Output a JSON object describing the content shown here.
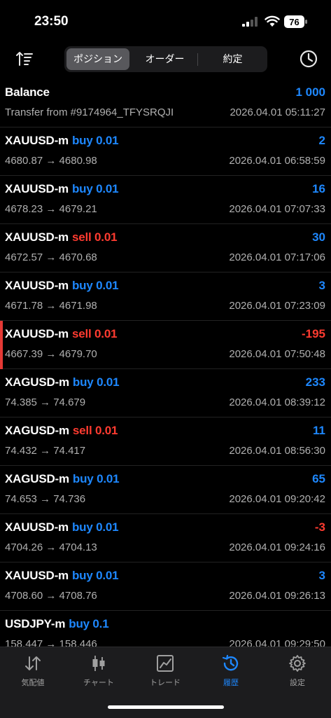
{
  "status": {
    "time": "23:50",
    "battery": "76"
  },
  "header": {
    "segments": [
      "ポジション",
      "オーダー",
      "約定"
    ],
    "active_segment": "ポジション"
  },
  "balance": {
    "label": "Balance",
    "amount": "1 000",
    "description": "Transfer from #9174964_TFYSRQJI",
    "time": "2026.04.01 05:11:27"
  },
  "deals": [
    {
      "symbol": "XAUUSD-m",
      "side": "buy 0.01",
      "type": "buy",
      "profit": "2",
      "profit_sign": "pos",
      "prices": "4680.87 → 4680.98",
      "time": "2026.04.01 06:58:59",
      "highlight": false
    },
    {
      "symbol": "XAUUSD-m",
      "side": "buy 0.01",
      "type": "buy",
      "profit": "16",
      "profit_sign": "pos",
      "prices": "4678.23 → 4679.21",
      "time": "2026.04.01 07:07:33",
      "highlight": false
    },
    {
      "symbol": "XAUUSD-m",
      "side": "sell 0.01",
      "type": "sell",
      "profit": "30",
      "profit_sign": "pos",
      "prices": "4672.57 → 4670.68",
      "time": "2026.04.01 07:17:06",
      "highlight": false
    },
    {
      "symbol": "XAUUSD-m",
      "side": "buy 0.01",
      "type": "buy",
      "profit": "3",
      "profit_sign": "pos",
      "prices": "4671.78 → 4671.98",
      "time": "2026.04.01 07:23:09",
      "highlight": false
    },
    {
      "symbol": "XAUUSD-m",
      "side": "sell 0.01",
      "type": "sell",
      "profit": "-195",
      "profit_sign": "neg",
      "prices": "4667.39 → 4679.70",
      "time": "2026.04.01 07:50:48",
      "highlight": true
    },
    {
      "symbol": "XAGUSD-m",
      "side": "buy 0.01",
      "type": "buy",
      "profit": "233",
      "profit_sign": "pos",
      "prices": "74.385 → 74.679",
      "time": "2026.04.01 08:39:12",
      "highlight": false
    },
    {
      "symbol": "XAGUSD-m",
      "side": "sell 0.01",
      "type": "sell",
      "profit": "11",
      "profit_sign": "pos",
      "prices": "74.432 → 74.417",
      "time": "2026.04.01 08:56:30",
      "highlight": false
    },
    {
      "symbol": "XAGUSD-m",
      "side": "buy 0.01",
      "type": "buy",
      "profit": "65",
      "profit_sign": "pos",
      "prices": "74.653 → 74.736",
      "time": "2026.04.01 09:20:42",
      "highlight": false
    },
    {
      "symbol": "XAUUSD-m",
      "side": "buy 0.01",
      "type": "buy",
      "profit": "-3",
      "profit_sign": "neg",
      "prices": "4704.26 → 4704.13",
      "time": "2026.04.01 09:24:16",
      "highlight": false
    },
    {
      "symbol": "XAUUSD-m",
      "side": "buy 0.01",
      "type": "buy",
      "profit": "3",
      "profit_sign": "pos",
      "prices": "4708.60 → 4708.76",
      "time": "2026.04.01 09:26:13",
      "highlight": false
    },
    {
      "symbol": "USDJPY-m",
      "side": "buy 0.1",
      "type": "buy",
      "profit": "",
      "profit_sign": "pos",
      "prices": "158.447 → 158.446",
      "time": "2026.04.01 09:29:50",
      "highlight": false
    }
  ],
  "tabs": [
    {
      "label": "気配値",
      "icon": "quotes-arrows-icon",
      "active": false
    },
    {
      "label": "チャート",
      "icon": "candlestick-chart-icon",
      "active": false
    },
    {
      "label": "トレード",
      "icon": "trade-chart-icon",
      "active": false
    },
    {
      "label": "履歴",
      "icon": "history-clock-icon",
      "active": true
    },
    {
      "label": "設定",
      "icon": "gear-icon",
      "active": false
    }
  ],
  "colors": {
    "buy": "#1e88ff",
    "sell": "#ff3b30",
    "active_tab": "#1e88ff"
  }
}
